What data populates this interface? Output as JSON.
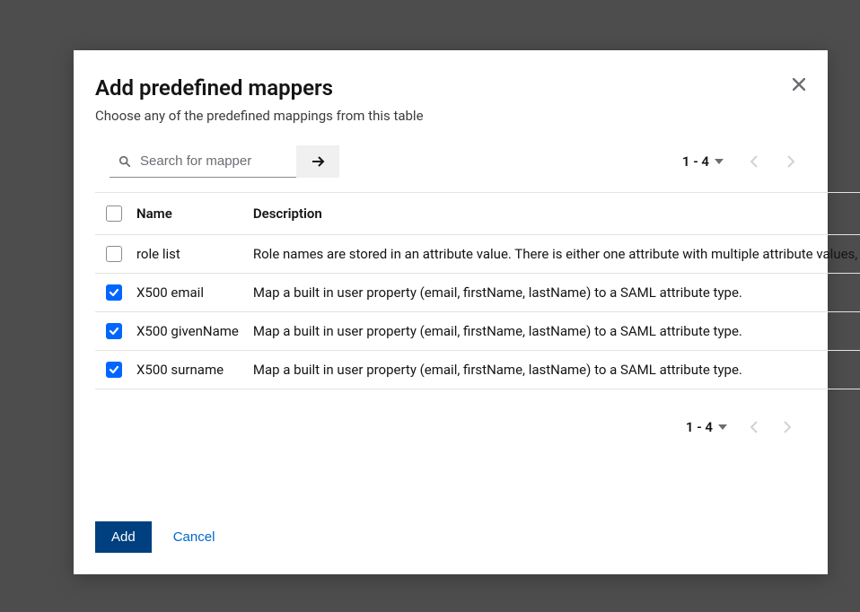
{
  "modal": {
    "title": "Add predefined mappers",
    "subtitle": "Choose any of the predefined mappings from this table"
  },
  "search": {
    "placeholder": "Search for mapper",
    "value": ""
  },
  "pagination": {
    "range": "1 - 4"
  },
  "table": {
    "columns": {
      "name": "Name",
      "description": "Description"
    },
    "select_all_checked": false,
    "rows": [
      {
        "checked": false,
        "name": "role list",
        "description": "Role names are stored in an attribute value. There is either one attribute with multiple attribute values,"
      },
      {
        "checked": true,
        "name": "X500 email",
        "description": "Map a built in user property (email, firstName, lastName) to a SAML attribute type."
      },
      {
        "checked": true,
        "name": "X500 givenName",
        "description": "Map a built in user property (email, firstName, lastName) to a SAML attribute type."
      },
      {
        "checked": true,
        "name": "X500 surname",
        "description": "Map a built in user property (email, firstName, lastName) to a SAML attribute type."
      }
    ]
  },
  "footer": {
    "add_label": "Add",
    "cancel_label": "Cancel"
  }
}
